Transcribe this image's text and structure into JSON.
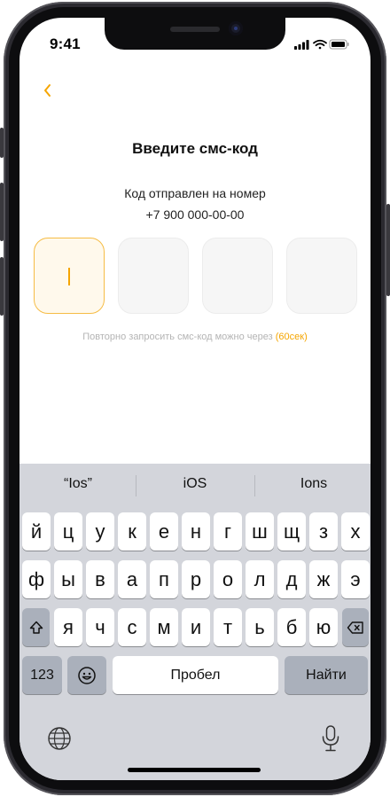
{
  "status_bar": {
    "time": "9:41"
  },
  "header": {
    "back_icon": "chevron-left-icon"
  },
  "content": {
    "title": "Введите смс-код",
    "subtitle_line1": "Код отправлен на номер",
    "phone_number": "+7 900 000-00-00",
    "code_length": 4,
    "resend_text": "Повторно запросить смс-код можно через",
    "resend_timer": "(60сек)"
  },
  "keyboard": {
    "suggestions": [
      "“Ios”",
      "iOS",
      "Ions"
    ],
    "row1": [
      "й",
      "ц",
      "у",
      "к",
      "е",
      "н",
      "г",
      "ш",
      "щ",
      "з",
      "х"
    ],
    "row2": [
      "ф",
      "ы",
      "в",
      "а",
      "п",
      "р",
      "о",
      "л",
      "д",
      "ж",
      "э"
    ],
    "row3": [
      "я",
      "ч",
      "с",
      "м",
      "и",
      "т",
      "ь",
      "б",
      "ю"
    ],
    "numbers_label": "123",
    "space_label": "Пробел",
    "return_label": "Найти",
    "icons": {
      "shift": "shift-icon",
      "backspace": "backspace-icon",
      "emoji": "emoji-icon",
      "globe": "globe-icon",
      "microphone": "microphone-icon"
    }
  },
  "colors": {
    "accent": "#f5a500",
    "keyboard_bg": "#d3d5db"
  }
}
